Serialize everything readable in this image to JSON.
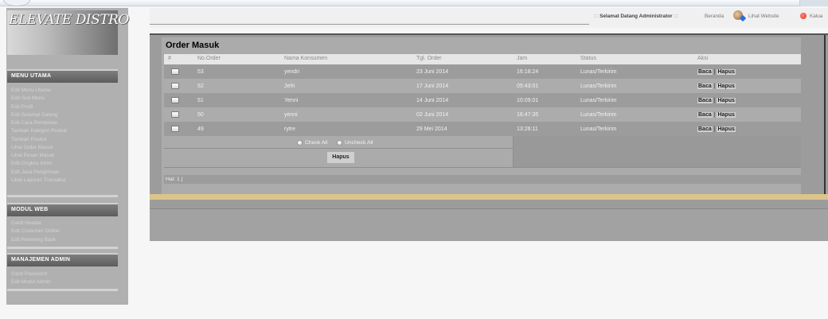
{
  "sidebar": {
    "logo": "ELEVATE DISTRO",
    "sections": [
      {
        "header": "MENU UTAMA",
        "items": [
          "Edit Menu Utama",
          "Edit Sub Menu",
          "Edit Profil",
          "Edit Selamat Datang",
          "Edit Cara Pembelian",
          "Tambah Kategori Produk",
          "Tambah Produk",
          "Lihat Order Masuk",
          "Lihat Pesan Masuk",
          "Edit Ongkos Kirim",
          "Edit Jasa Pengiriman",
          "Lihat Laporan Transaksi"
        ]
      },
      {
        "header": "MODUL WEB",
        "items": [
          "Ganti Header",
          "Edit Costumer Online",
          "Edit Rekening Bank"
        ]
      },
      {
        "header": "MANAJEMEN ADMIN",
        "items": [
          "Ganti Password",
          "Edit Modul Admin"
        ]
      }
    ]
  },
  "topbar": {
    "welcome_prefix": ":::",
    "welcome": "Selamat Datang Administrator",
    "welcome_suffix": ":::",
    "beranda": "Beranda",
    "lihat_website": "Lihat Website",
    "keluar": "Kalua"
  },
  "main": {
    "title": "Order Masuk",
    "columns": [
      "#",
      "No.Order",
      "Nama Konsumen",
      "Tgl. Order",
      "Jam",
      "Status",
      "Aksi"
    ],
    "rows": [
      {
        "no": "53",
        "nama": "yendri",
        "tgl": "23 Juni 2014",
        "jam": "16:18:24",
        "status": "Lunas/Terkirim",
        "baca": "Baca",
        "hapus": "Hapus"
      },
      {
        "no": "52",
        "nama": "Jefri",
        "tgl": "17 Juni 2014",
        "jam": "05:43:01",
        "status": "Lunas/Terkirim",
        "baca": "Baca",
        "hapus": "Hapus"
      },
      {
        "no": "51",
        "nama": "Yenni",
        "tgl": "14 Juni 2014",
        "jam": "10:09:01",
        "status": "Lunas/Terkirim",
        "baca": "Baca",
        "hapus": "Hapus"
      },
      {
        "no": "50",
        "nama": "yenni",
        "tgl": "02 Juni 2014",
        "jam": "16:47:35",
        "status": "Lunas/Terkirim",
        "baca": "Baca",
        "hapus": "Hapus"
      },
      {
        "no": "49",
        "nama": "rytre",
        "tgl": "29 Mei 2014",
        "jam": "13:26:11",
        "status": "Lunas/Terkirim",
        "baca": "Baca",
        "hapus": "Hapus"
      }
    ],
    "check_all": "Check All",
    "uncheck_all": "Uncheck All",
    "hapus_button": "Hapus",
    "pagination": "Hal: 1 |",
    "action_separator": "|"
  }
}
